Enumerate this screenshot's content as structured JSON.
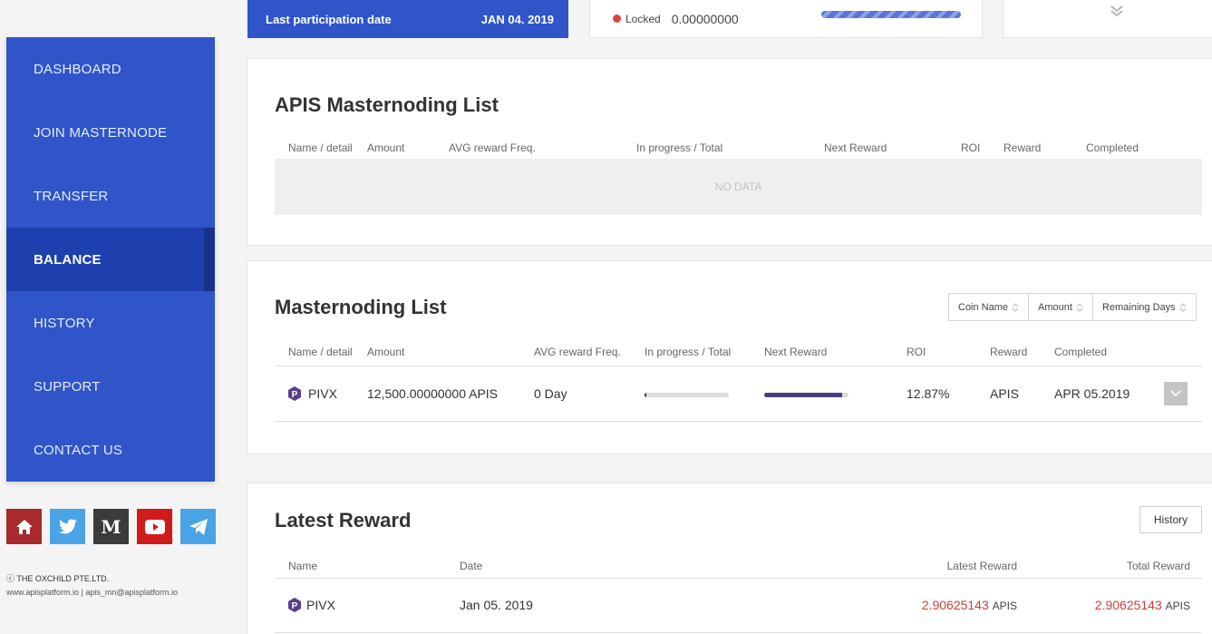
{
  "sidebar": {
    "items": [
      {
        "label": "DASHBOARD"
      },
      {
        "label": "JOIN MASTERNODE"
      },
      {
        "label": "TRANSFER"
      },
      {
        "label": "BALANCE",
        "active": true
      },
      {
        "label": "HISTORY"
      },
      {
        "label": "SUPPORT"
      },
      {
        "label": "CONTACT US"
      }
    ]
  },
  "social_icons": [
    {
      "name": "home-icon",
      "color": "#a82a2a"
    },
    {
      "name": "twitter-icon",
      "color": "#4aa3e4"
    },
    {
      "name": "medium-icon",
      "color": "#3b3b3b"
    },
    {
      "name": "youtube-icon",
      "color": "#d11b1b"
    },
    {
      "name": "telegram-icon",
      "color": "#4aa3e4"
    }
  ],
  "footer": {
    "company": "ⓒ THE OXCHILD PTE.LTD.",
    "contact": "www.apisplatform.io  |  apis_mn@apisplatform.io"
  },
  "top": {
    "last_participation_label": "Last participation date",
    "last_participation_value": "JAN 04. 2019",
    "locked_label": "Locked",
    "locked_value": "0.00000000"
  },
  "apis_list": {
    "title": "APIS Masternoding List",
    "headers": [
      "Name / detail",
      "Amount",
      "AVG reward Freq.",
      "In progress / Total",
      "Next Reward",
      "ROI",
      "Reward",
      "Completed"
    ],
    "empty_text": "NO DATA"
  },
  "mn_list": {
    "title": "Masternoding List",
    "sort_buttons": [
      "Coin Name",
      "Amount",
      "Remaining Days"
    ],
    "headers": [
      "Name / detail",
      "Amount",
      "AVG reward Freq.",
      "In progress / Total",
      "Next Reward",
      "ROI",
      "Reward",
      "Completed"
    ],
    "row": {
      "name": "PIVX",
      "amount": "12,500.00000000 APIS",
      "freq": "0 Day",
      "progress": 0.02,
      "next_reward": 0.92,
      "roi": "12.87%",
      "reward": "APIS",
      "completed": "APR 05.2019"
    }
  },
  "latest": {
    "title": "Latest Reward",
    "history_label": "History",
    "headers": [
      "Name",
      "Date",
      "Latest Reward",
      "Total Reward"
    ],
    "row": {
      "name": "PIVX",
      "date": "Jan 05. 2019",
      "latest_value": "2.90625143",
      "latest_unit": "APIS",
      "total_value": "2.90625143",
      "total_unit": "APIS"
    }
  },
  "colors": {
    "brand": "#2f55c8",
    "brand_dark": "#1e40ae",
    "pivx": "#5b3f8c",
    "reward_red": "#c6423a"
  }
}
